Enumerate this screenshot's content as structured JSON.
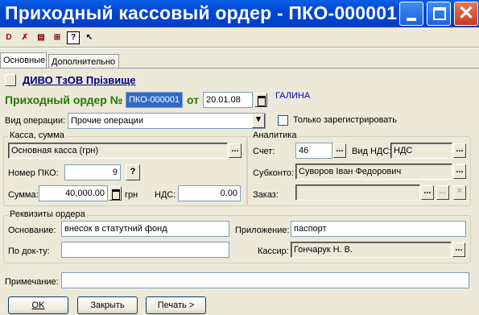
{
  "window": {
    "title": "Приходный кассовый ордер - ПКО-000001"
  },
  "tabs": [
    {
      "label": "Основные"
    },
    {
      "label": "Дополнительно"
    }
  ],
  "header": {
    "counterparty": "ДИВО ТзОВ Прізвище",
    "order_label": "Приходный ордер №",
    "order_number": "ПКО-000001",
    "date_label": "от",
    "date": "20.01.08",
    "user": "ГАЛИНА"
  },
  "operation": {
    "label": "Вид операции:",
    "value": "Прочие операции",
    "only_register": "Только зарегистрировать"
  },
  "cash": {
    "group_title": "Касса, сумма",
    "cashbox": "Основная касса (грн)",
    "pko_label": "Номер ПКО:",
    "pko_value": "9",
    "help": "?",
    "sum_label": "Сумма:",
    "sum_value": "40,000.00",
    "currency": "грн",
    "vat_label": "НДС:",
    "vat_value": "0.00"
  },
  "analytics": {
    "group_title": "Аналитика",
    "account_label": "Счет:",
    "account_value": "46",
    "vat_type_label": "Вид НДС:",
    "vat_type_value": "НДС",
    "subconto_label": "Субконто:",
    "subconto_value": "Суворов Іван Федорович",
    "order_label": "Заказ:",
    "order_value": ""
  },
  "details": {
    "group_title": "Реквизиты ордера",
    "basis_label": "Основание:",
    "basis_value": "внесок в статутний фонд",
    "attachment_label": "Приложение:",
    "attachment_value": "паспорт",
    "doc_label": "По док-ту:",
    "doc_value": "",
    "cashier_label": "Кассир:",
    "cashier_value": "Гончарук Н. В."
  },
  "note": {
    "label": "Примечание:",
    "value": ""
  },
  "buttons": {
    "ok": "OK",
    "close": "Закрыть",
    "print": "Печать >"
  },
  "ellipsis": "...",
  "clear_glyph": "×"
}
